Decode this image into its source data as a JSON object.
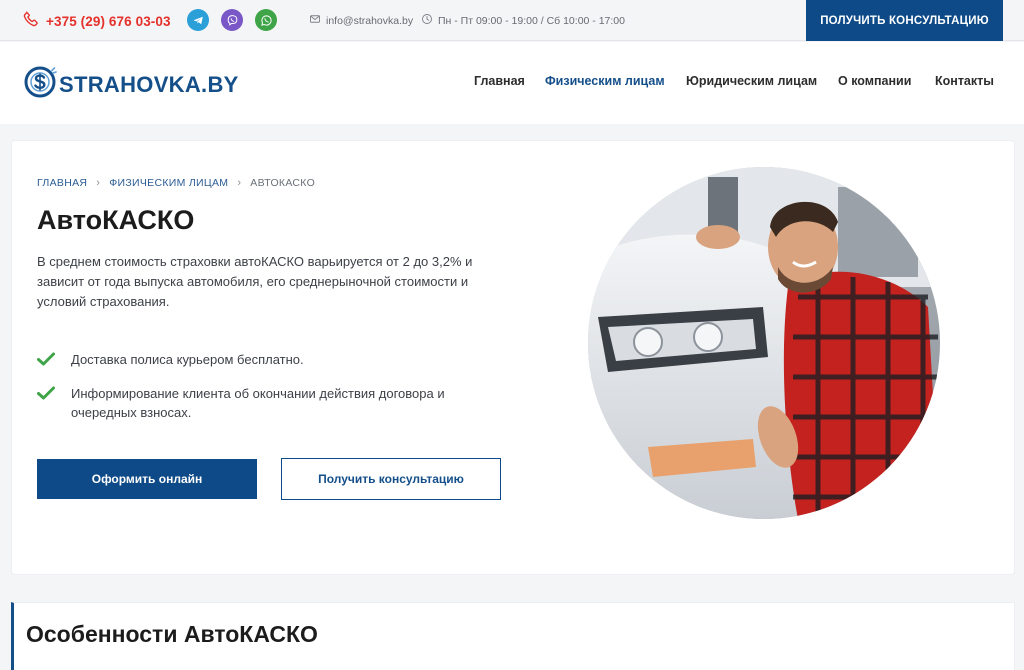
{
  "topbar": {
    "phone": "+375 (29) 676 03-03",
    "email": "info@strahovka.by",
    "hours": "Пн - Пт 09:00 - 19:00 / Сб 10:00 - 17:00",
    "consult_button": "ПОЛУЧИТЬ КОНСУЛЬТАЦИЮ",
    "icons": [
      "phone-icon",
      "telegram-icon",
      "viber-icon",
      "whatsapp-icon",
      "email-icon",
      "clock-icon"
    ]
  },
  "header": {
    "logo_text": "STRAHOVKA.BY",
    "nav": [
      {
        "label": "Главная",
        "active": false
      },
      {
        "label": "Физическим лицам",
        "active": true
      },
      {
        "label": "Юридическим лицам",
        "active": false
      },
      {
        "label": "О компании",
        "active": false
      },
      {
        "label": "Контакты",
        "active": false
      }
    ]
  },
  "breadcrumb": {
    "items": [
      "ГЛАВНАЯ",
      "ФИЗИЧЕСКИМ ЛИЦАМ",
      "АВТОКАСКО"
    ],
    "separator": "›"
  },
  "hero": {
    "title": "АвтоКАСКО",
    "description": "В среднем стоимость страховки автоКАСКО варьируется от 2 до 3,2% и зависит от года выпуска автомобиля, его среднерыночной стоимости и условий страхования.",
    "benefits": [
      "Доставка полиса курьером бесплатно.",
      "Информирование клиента об окончании действия договора и очередных взносах."
    ],
    "primary_button": "Оформить онлайн",
    "secondary_button": "Получить консультацию"
  },
  "features": {
    "title": "Особенности АвтоКАСКО"
  },
  "colors": {
    "brand_blue": "#0d4a87",
    "phone_red": "#e5312b",
    "check_green": "#3ea447",
    "telegram": "#2a9fd8",
    "viber": "#7a57c6",
    "whatsapp": "#3ea447"
  }
}
